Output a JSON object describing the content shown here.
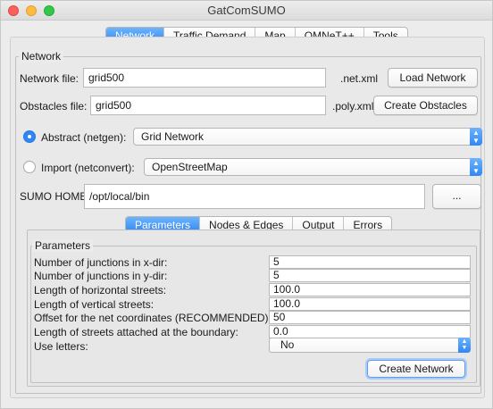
{
  "window": {
    "title": "GatComSUMO"
  },
  "main_tabs": [
    {
      "label": "Network",
      "active": true
    },
    {
      "label": "Traffic Demand",
      "active": false
    },
    {
      "label": "Map",
      "active": false
    },
    {
      "label": "OMNeT++",
      "active": false
    },
    {
      "label": "Tools",
      "active": false
    }
  ],
  "network": {
    "legend": "Network",
    "network_file_label": "Network file:",
    "network_file_value": "grid500",
    "network_file_ext": ".net.xml",
    "load_button": "Load Network",
    "obstacles_file_label": "Obstacles file:",
    "obstacles_file_value": "grid500",
    "obstacles_file_ext": ".poly.xml",
    "create_obstacles_button": "Create Obstacles",
    "abstract_label": "Abstract (netgen):",
    "abstract_selected": true,
    "abstract_value": "Grid Network",
    "import_label": "Import (netconvert):",
    "import_selected": false,
    "import_value": "OpenStreetMap",
    "sumo_home_label": "SUMO HOME:",
    "sumo_home_value": "/opt/local/bin",
    "browse_button": "..."
  },
  "sub_tabs": [
    {
      "label": "Parameters",
      "active": true
    },
    {
      "label": "Nodes & Edges",
      "active": false
    },
    {
      "label": "Output",
      "active": false
    },
    {
      "label": "Errors",
      "active": false
    }
  ],
  "parameters": {
    "legend": "Parameters",
    "rows": [
      {
        "label": "Number of junctions in x-dir:",
        "value": "5"
      },
      {
        "label": "Number of junctions in y-dir:",
        "value": "5"
      },
      {
        "label": "Length of horizontal streets:",
        "value": "100.0"
      },
      {
        "label": "Length of vertical streets:",
        "value": "100.0"
      },
      {
        "label": "Offset for the net coordinates (RECOMMENDED):",
        "value": "50"
      },
      {
        "label": "Length of streets attached at the boundary:",
        "value": "0.0"
      }
    ],
    "use_letters_label": "Use letters:",
    "use_letters_value": "No",
    "create_network_button": "Create Network"
  },
  "colors": {
    "accent": "#2f86f5",
    "close": "#fc605c",
    "minimize": "#fdbc40",
    "maximize": "#34c84a"
  }
}
